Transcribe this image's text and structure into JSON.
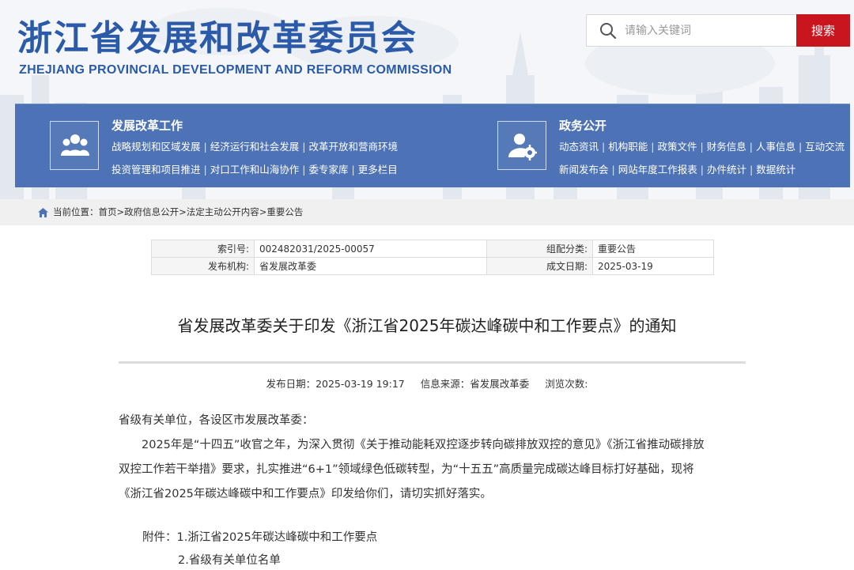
{
  "header": {
    "title_cn": "浙江省发展和改革委员会",
    "title_en": "ZHEJIANG PROVINCIAL DEVELOPMENT AND REFORM COMMISSION"
  },
  "search": {
    "placeholder": "请输入关键词",
    "button_label": "搜索"
  },
  "nav": {
    "left": {
      "icon": "people-group-icon",
      "title": "发展改革工作",
      "row1": [
        "战略规划和区域发展",
        "经济运行和社会发展",
        "改革开放和营商环境"
      ],
      "row2": [
        "投资管理和项目推进",
        "对口工作和山海协作",
        "委专家库",
        "更多栏目"
      ]
    },
    "right": {
      "icon": "user-gear-icon",
      "title": "政务公开",
      "row1": [
        "动态资讯",
        "机构职能",
        "政策文件",
        "财务信息",
        "人事信息",
        "互动交流"
      ],
      "row2": [
        "新闻发布会",
        "网站年度工作报表",
        "办件统计",
        "数据统计"
      ]
    }
  },
  "breadcrumb": {
    "prefix": "当前位置：",
    "items": [
      "首页",
      "政府信息公开",
      "法定主动公开内容",
      "重要公告"
    ],
    "separator": ">"
  },
  "meta": {
    "index_label": "索引号:",
    "index_value": "002482031/2025-00057",
    "category_label": "组配分类:",
    "category_value": "重要公告",
    "publisher_label": "发布机构:",
    "publisher_value": "省发展改革委",
    "date_label": "成文日期:",
    "date_value": "2025-03-19"
  },
  "article": {
    "title": "省发展改革委关于印发《浙江省2025年碳达峰碳中和工作要点》的通知",
    "publish_date": "发布日期：2025-03-19 19:17",
    "source": "信息来源：省发展改革委",
    "views": "浏览次数:",
    "greeting": "省级有关单位，各设区市发展改革委：",
    "para_line1": "2025年是“十四五”收官之年，为深入贯彻《关于推动能耗双控逐步转向碳排放双控的意见》《浙江省推动碳排放",
    "para_line2": "双控工作若干举措》要求，扎实推进“6+1”领域绿色低碳转型，为“十五五”高质量完成碳达峰目标打好基础，现将",
    "para_line3": "《浙江省2025年碳达峰碳中和工作要点》印发给你们，请切实抓好落实。",
    "attachment_label": "附件：",
    "attachment_1": "1.浙江省2025年碳达峰碳中和工作要点",
    "attachment_2": "2.省级有关单位名单"
  },
  "colors": {
    "brand_blue": "#2a5aa8",
    "nav_blue": "#4d72b5",
    "search_red": "#c9151e"
  }
}
